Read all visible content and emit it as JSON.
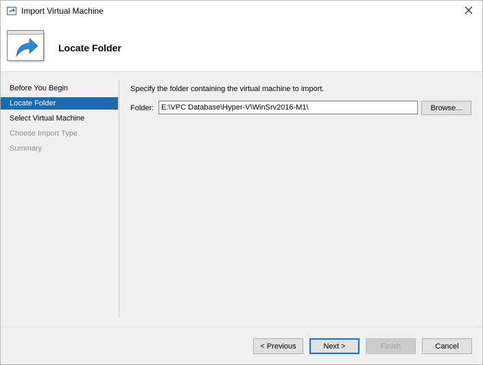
{
  "window": {
    "title": "Import Virtual Machine",
    "close_glyph": "✕"
  },
  "header": {
    "title": "Locate Folder",
    "icon": "import-arrow-icon"
  },
  "nav": {
    "items": [
      {
        "label": "Before You Begin",
        "state": "normal"
      },
      {
        "label": "Locate Folder",
        "state": "active"
      },
      {
        "label": "Select Virtual Machine",
        "state": "normal"
      },
      {
        "label": "Choose Import Type",
        "state": "disabled"
      },
      {
        "label": "Summary",
        "state": "disabled"
      }
    ]
  },
  "content": {
    "description": "Specify the folder containing the virtual machine to import.",
    "folder_label": "Folder:",
    "folder_value": "E:\\VPC Database\\Hyper-V\\WinSrv2016-M1\\",
    "browse_label": "Browse..."
  },
  "footer": {
    "previous_label": "< Previous",
    "next_label": "Next >",
    "finish_label": "Finish",
    "cancel_label": "Cancel"
  },
  "colors": {
    "accent": "#1c6ab3",
    "default_button_border": "#0078d7"
  }
}
